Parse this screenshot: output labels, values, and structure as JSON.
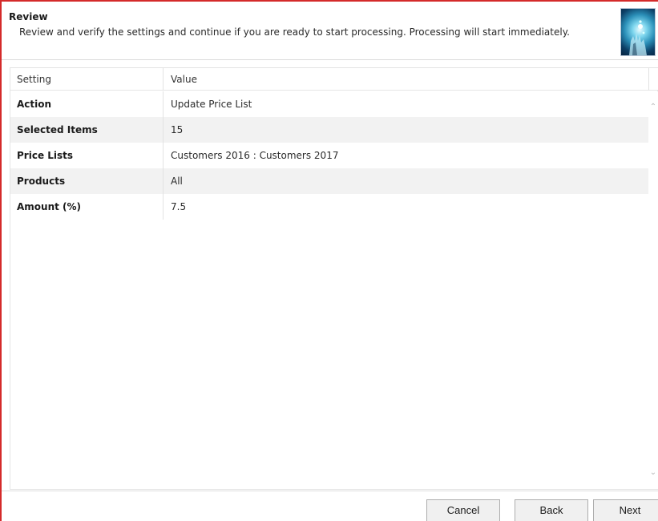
{
  "header": {
    "title": "Review",
    "description": "Review and verify the settings and continue if you are ready to start processing. Processing will start immediately.",
    "image": "wizard-banner-icon"
  },
  "grid": {
    "columns": [
      "Setting",
      "Value"
    ],
    "rows": [
      {
        "setting": "Action",
        "value": "Update Price List"
      },
      {
        "setting": "Selected Items",
        "value": "15"
      },
      {
        "setting": "Price Lists",
        "value": "Customers 2016 : Customers 2017"
      },
      {
        "setting": "Products",
        "value": "All"
      },
      {
        "setting": "Amount (%)",
        "value": "7.5"
      }
    ],
    "scroll_up_icon": "chevron-up-icon",
    "scroll_down_icon": "chevron-down-icon"
  },
  "footer": {
    "cancel_label": "Cancel",
    "back_label": "Back",
    "next_label": "Next"
  },
  "colors": {
    "frame_border": "#d42a2a",
    "alt_row": "#f2f2f2",
    "button_bg": "#f0f0f0"
  }
}
